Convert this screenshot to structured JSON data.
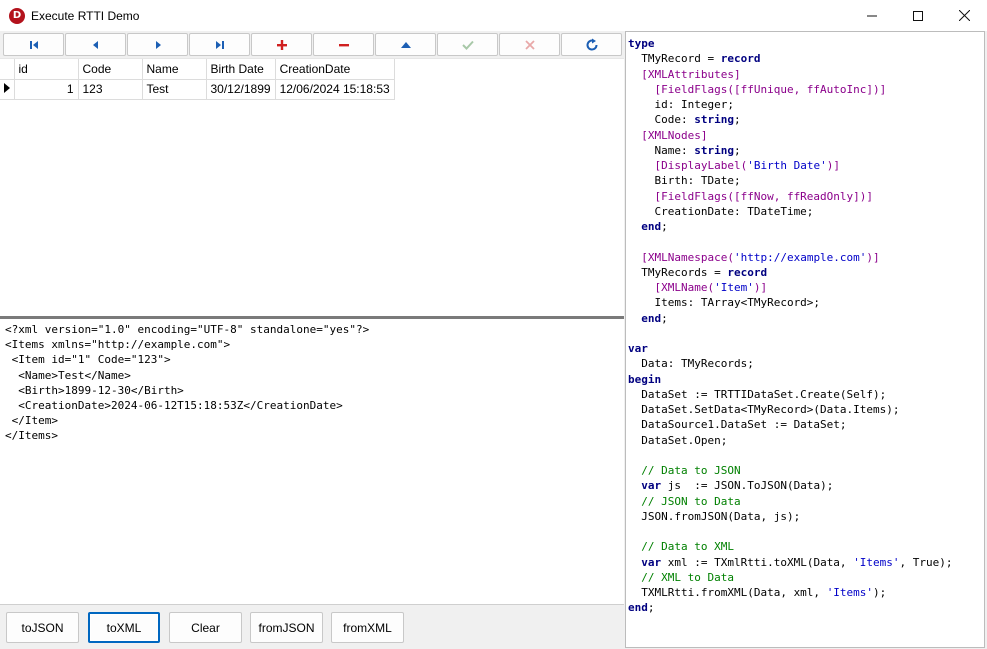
{
  "window": {
    "title": "Execute RTTI Demo",
    "icon_letter": "D",
    "controls": [
      "minimize-icon",
      "maximize-icon",
      "close-icon"
    ]
  },
  "navigator": {
    "buttons": [
      {
        "name": "first-record",
        "icon": "first-icon",
        "color": "#1c5fb4"
      },
      {
        "name": "prior-record",
        "icon": "prior-icon",
        "color": "#1c5fb4"
      },
      {
        "name": "next-record",
        "icon": "next-icon",
        "color": "#1c5fb4"
      },
      {
        "name": "last-record",
        "icon": "last-icon",
        "color": "#1c5fb4"
      },
      {
        "name": "insert-record",
        "icon": "plus-icon",
        "color": "#d02020"
      },
      {
        "name": "delete-record",
        "icon": "minus-icon",
        "color": "#d02020"
      },
      {
        "name": "edit-record",
        "icon": "up-icon",
        "color": "#1c5fb4"
      },
      {
        "name": "post-record",
        "icon": "check-icon",
        "color": "#a8c8a8"
      },
      {
        "name": "cancel-record",
        "icon": "cross-icon",
        "color": "#e8a8a8"
      },
      {
        "name": "refresh-records",
        "icon": "refresh-icon",
        "color": "#1c5fb4"
      }
    ]
  },
  "grid": {
    "columns": [
      "id",
      "Code",
      "Name",
      "Birth Date",
      "CreationDate"
    ],
    "rows": [
      {
        "id": "1",
        "code": "123",
        "name": "Test",
        "birth": "30/12/1899",
        "created": "12/06/2024 15:18:53"
      }
    ]
  },
  "xml_output": "<?xml version=\"1.0\" encoding=\"UTF-8\" standalone=\"yes\"?>\n<Items xmlns=\"http://example.com\">\n <Item id=\"1\" Code=\"123\">\n  <Name>Test</Name>\n  <Birth>1899-12-30</Birth>\n  <CreationDate>2024-06-12T15:18:53Z</CreationDate>\n </Item>\n</Items>",
  "actions": {
    "to_json": "toJSON",
    "to_xml": "toXML",
    "clear": "Clear",
    "from_json": "fromJSON",
    "from_xml": "fromXML"
  },
  "code_lines": [
    [
      {
        "t": "type",
        "c": "kw"
      }
    ],
    [
      {
        "t": "  TMyRecord = "
      },
      {
        "t": "record",
        "c": "kw"
      }
    ],
    [
      {
        "t": "  [XMLAttributes]",
        "c": "attr"
      }
    ],
    [
      {
        "t": "    [FieldFlags([ffUnique, ffAutoInc])]",
        "c": "attr"
      }
    ],
    [
      {
        "t": "    id: Integer;"
      }
    ],
    [
      {
        "t": "    Code: "
      },
      {
        "t": "string",
        "c": "kw"
      },
      {
        "t": ";"
      }
    ],
    [
      {
        "t": "  [XMLNodes]",
        "c": "attr"
      }
    ],
    [
      {
        "t": "    Name: "
      },
      {
        "t": "string",
        "c": "kw"
      },
      {
        "t": ";"
      }
    ],
    [
      {
        "t": "    [DisplayLabel(",
        "c": "attr"
      },
      {
        "t": "'Birth Date'",
        "c": "str"
      },
      {
        "t": ")]",
        "c": "attr"
      }
    ],
    [
      {
        "t": "    Birth: TDate;"
      }
    ],
    [
      {
        "t": "    [FieldFlags([ffNow, ffReadOnly])]",
        "c": "attr"
      }
    ],
    [
      {
        "t": "    CreationDate: TDateTime;"
      }
    ],
    [
      {
        "t": "  "
      },
      {
        "t": "end",
        "c": "kw"
      },
      {
        "t": ";"
      }
    ],
    [
      {
        "t": ""
      }
    ],
    [
      {
        "t": "  [XMLNamespace(",
        "c": "attr"
      },
      {
        "t": "'http://example.com'",
        "c": "str"
      },
      {
        "t": ")]",
        "c": "attr"
      }
    ],
    [
      {
        "t": "  TMyRecords = "
      },
      {
        "t": "record",
        "c": "kw"
      }
    ],
    [
      {
        "t": "    [XMLName(",
        "c": "attr"
      },
      {
        "t": "'Item'",
        "c": "str"
      },
      {
        "t": ")]",
        "c": "attr"
      }
    ],
    [
      {
        "t": "    Items: TArray<TMyRecord>;"
      }
    ],
    [
      {
        "t": "  "
      },
      {
        "t": "end",
        "c": "kw"
      },
      {
        "t": ";"
      }
    ],
    [
      {
        "t": ""
      }
    ],
    [
      {
        "t": "var",
        "c": "kw"
      }
    ],
    [
      {
        "t": "  Data: TMyRecords;"
      }
    ],
    [
      {
        "t": "begin",
        "c": "kw"
      }
    ],
    [
      {
        "t": "  DataSet := TRTTIDataSet.Create(Self);"
      }
    ],
    [
      {
        "t": "  DataSet.SetData<TMyRecord>(Data.Items);"
      }
    ],
    [
      {
        "t": "  DataSource1.DataSet := DataSet;"
      }
    ],
    [
      {
        "t": "  DataSet.Open;"
      }
    ],
    [
      {
        "t": ""
      }
    ],
    [
      {
        "t": "  // Data to JSON",
        "c": "cmt"
      }
    ],
    [
      {
        "t": "  "
      },
      {
        "t": "var",
        "c": "kw"
      },
      {
        "t": " js  := JSON.ToJSON(Data);"
      }
    ],
    [
      {
        "t": "  // JSON to Data",
        "c": "cmt"
      }
    ],
    [
      {
        "t": "  JSON.fromJSON(Data, js);"
      }
    ],
    [
      {
        "t": ""
      }
    ],
    [
      {
        "t": "  // Data to XML",
        "c": "cmt"
      }
    ],
    [
      {
        "t": "  "
      },
      {
        "t": "var",
        "c": "kw"
      },
      {
        "t": " xml := TXmlRtti.toXML(Data, "
      },
      {
        "t": "'Items'",
        "c": "str"
      },
      {
        "t": ", True);"
      }
    ],
    [
      {
        "t": "  // XML to Data",
        "c": "cmt"
      }
    ],
    [
      {
        "t": "  TXMLRtti.fromXML(Data, xml, "
      },
      {
        "t": "'Items'",
        "c": "str"
      },
      {
        "t": ");"
      }
    ],
    [
      {
        "t": "end",
        "c": "kw"
      },
      {
        "t": ";"
      }
    ]
  ]
}
